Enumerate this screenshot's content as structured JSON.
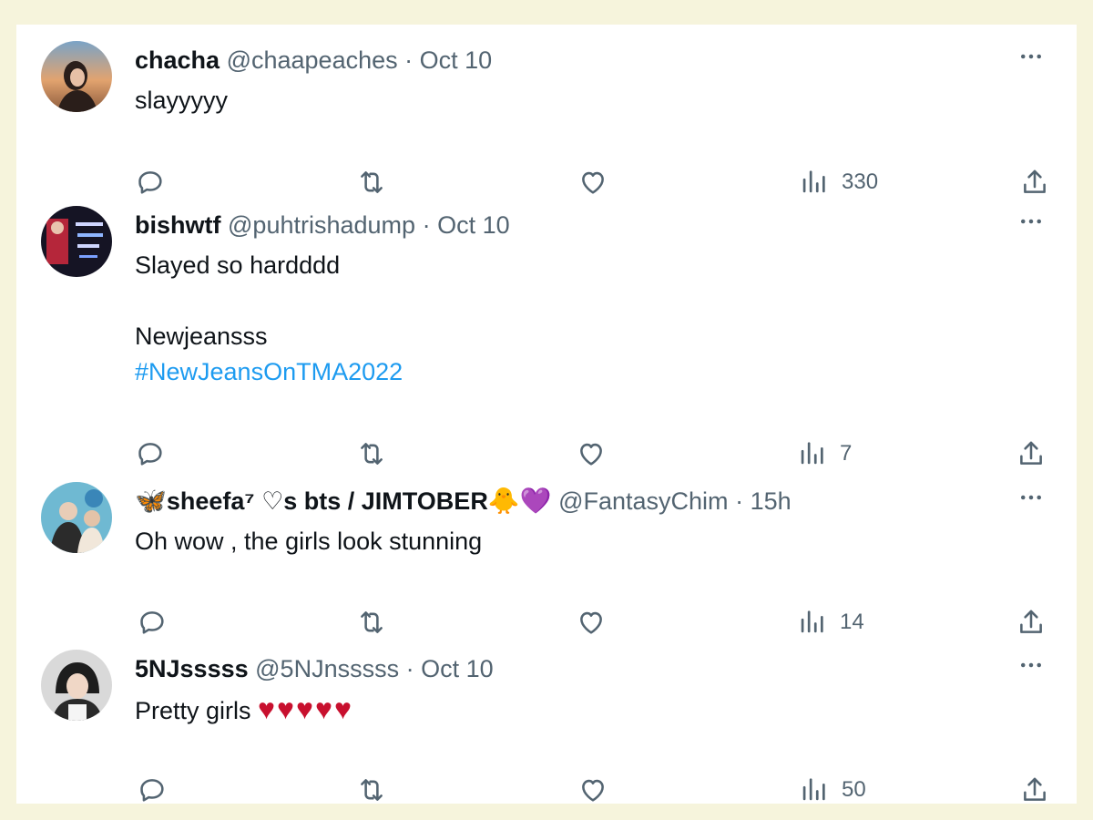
{
  "tweets": [
    {
      "name": "chacha",
      "handle": "@chaapeaches",
      "time": "Oct 10",
      "lines": [
        "slayyyyy"
      ],
      "views": "330"
    },
    {
      "name": "bishwtf",
      "handle": "@puhtrishadump",
      "time": "Oct 10",
      "lines": [
        "Slayed so hardddd",
        "",
        "Newjeansss"
      ],
      "hashtag": "#NewJeansOnTMA2022",
      "views": "7"
    },
    {
      "name_prefix_emoji": "🦋",
      "name": "sheefa⁷ ♡s bts / JIMTOBER",
      "name_suffix_emoji": "🐥💜",
      "handle": "@FantasyChim",
      "time": "15h",
      "lines": [
        "Oh wow , the girls look stunning"
      ],
      "views": "14"
    },
    {
      "name": "5NJsssss",
      "handle": "@5NJnsssss",
      "time": "Oct 10",
      "lines": [
        "Pretty girls"
      ],
      "hearts": "♥♥♥♥♥",
      "views": "50"
    }
  ],
  "separator": "·",
  "icons": {
    "reply": "reply-icon",
    "retweet": "retweet-icon",
    "like": "like-icon",
    "views": "views-icon",
    "share": "share-icon",
    "more": "more-icon"
  },
  "colors": {
    "background": "#f6f4dc",
    "card": "#ffffff",
    "text": "#0f1419",
    "secondary": "#536471",
    "link": "#1d9bf0",
    "heart": "#c8102e"
  }
}
